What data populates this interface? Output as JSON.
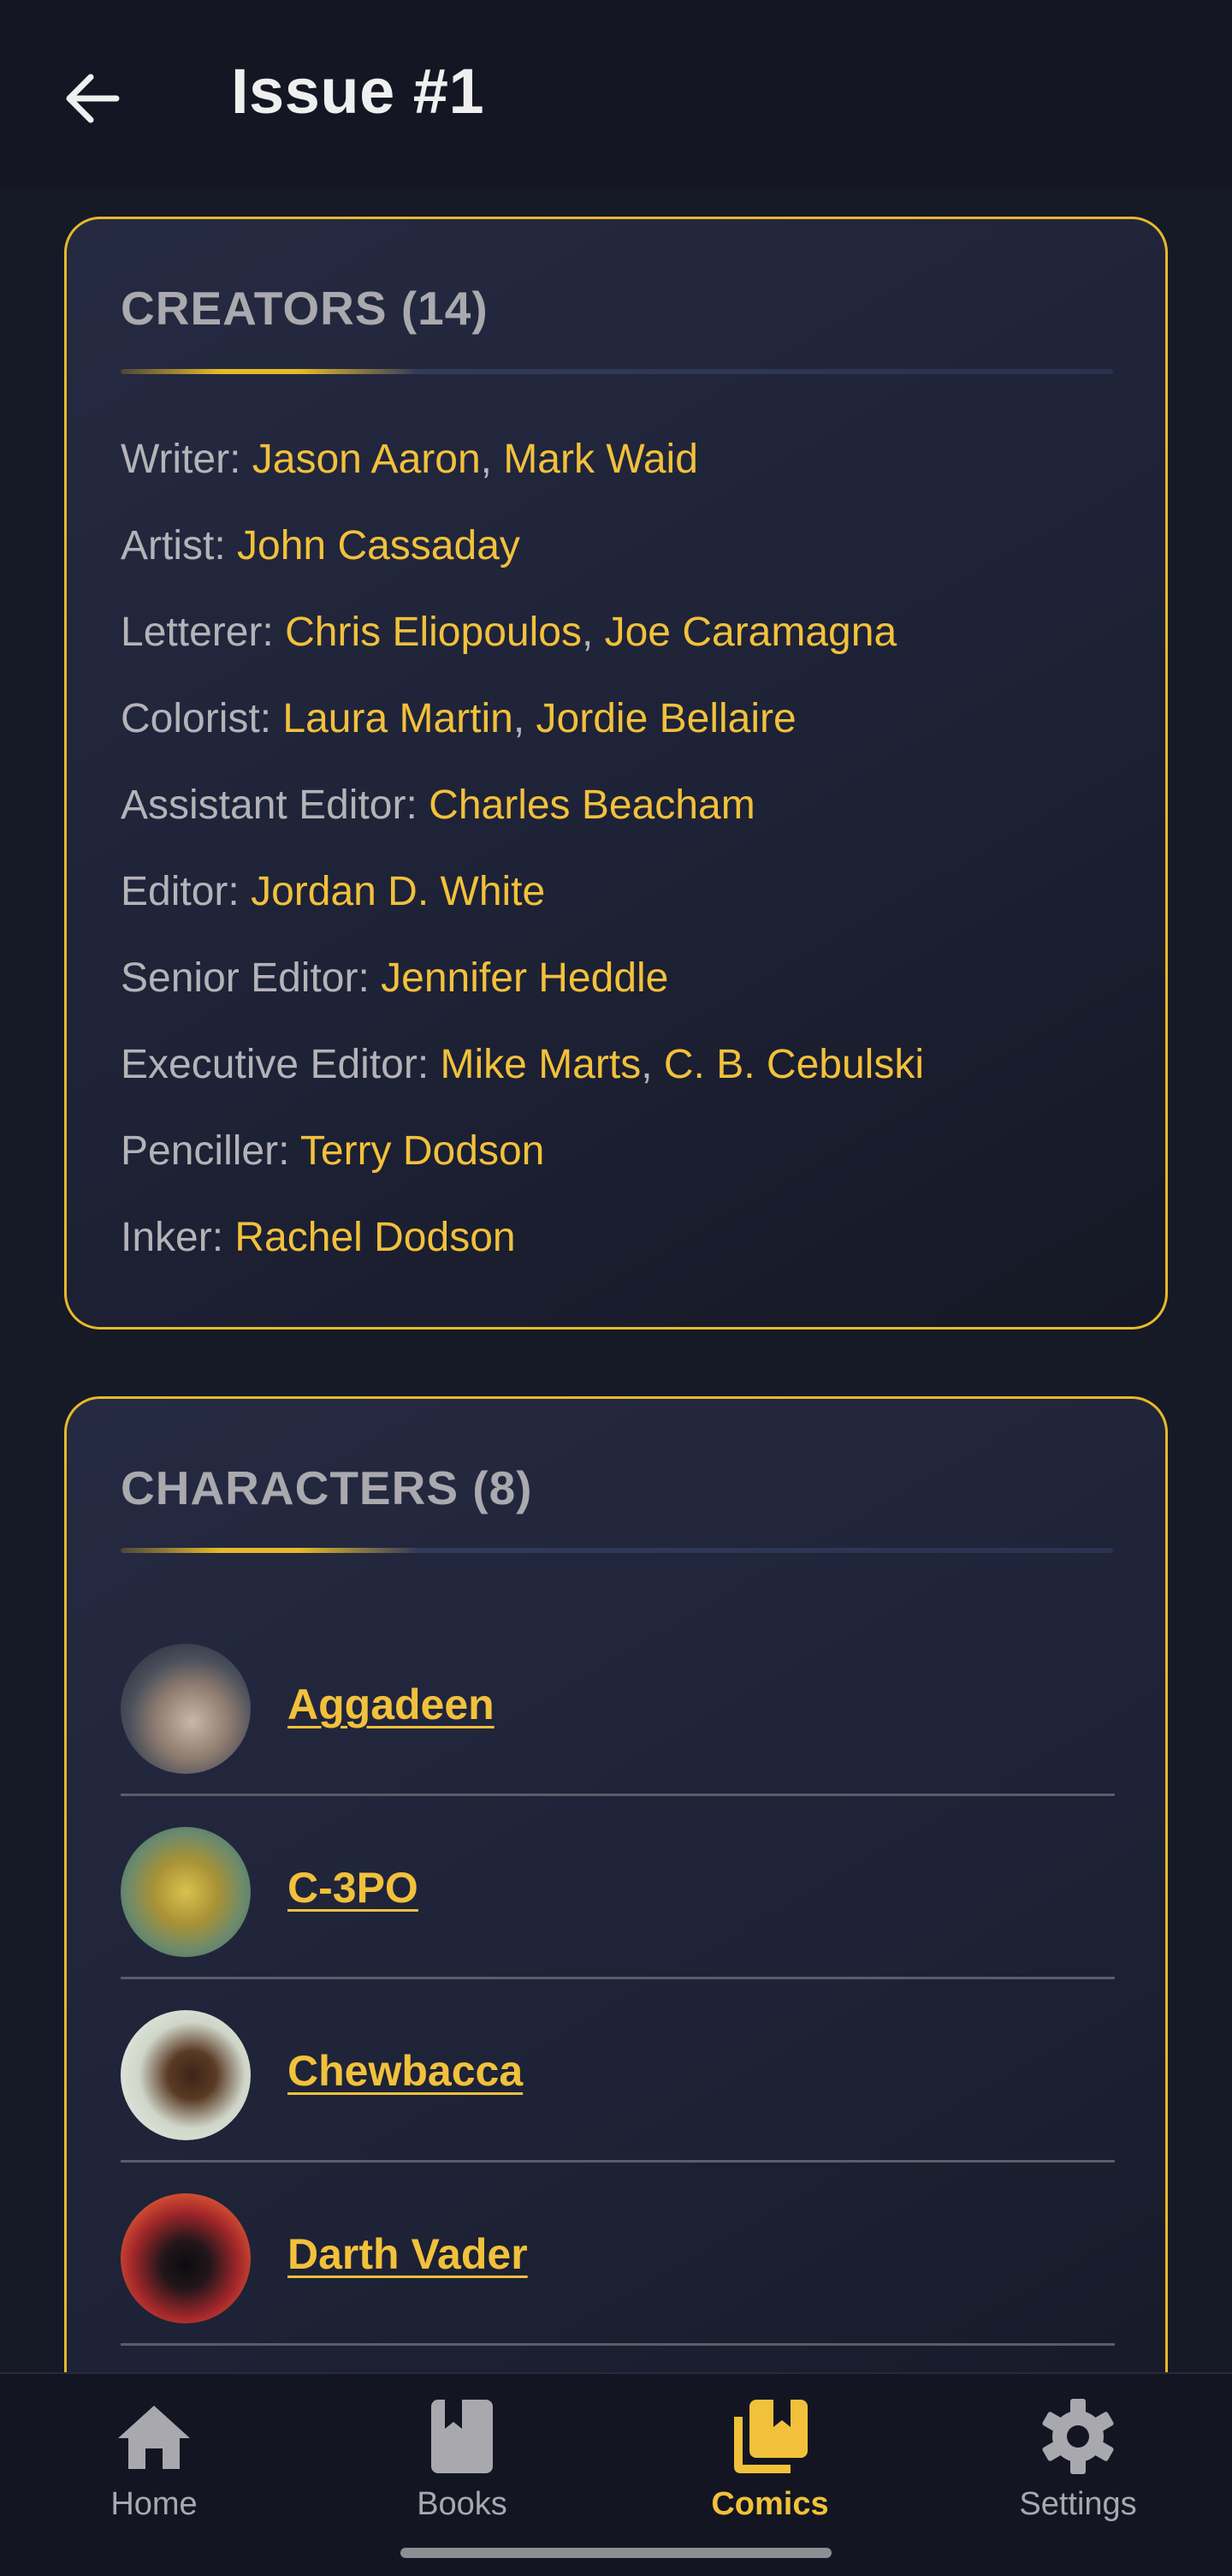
{
  "header": {
    "title": "Issue #1",
    "back_icon": "arrow-left-icon"
  },
  "creators": {
    "title": "CREATORS (14)",
    "roles": [
      {
        "role": "Writer:",
        "names": [
          "Jason Aaron",
          "Mark Waid"
        ]
      },
      {
        "role": "Artist:",
        "names": [
          "John Cassaday"
        ]
      },
      {
        "role": "Letterer:",
        "names": [
          "Chris Eliopoulos",
          "Joe Caramagna"
        ]
      },
      {
        "role": "Colorist:",
        "names": [
          "Laura Martin",
          "Jordie Bellaire"
        ]
      },
      {
        "role": "Assistant Editor:",
        "names": [
          "Charles Beacham"
        ]
      },
      {
        "role": "Editor:",
        "names": [
          "Jordan D. White"
        ]
      },
      {
        "role": "Senior Editor:",
        "names": [
          "Jennifer Heddle"
        ]
      },
      {
        "role": "Executive Editor:",
        "names": [
          "Mike Marts",
          "C. B. Cebulski"
        ]
      },
      {
        "role": "Penciller:",
        "names": [
          "Terry Dodson"
        ]
      },
      {
        "role": "Inker:",
        "names": [
          "Rachel Dodson"
        ]
      }
    ]
  },
  "characters": {
    "title": "CHARACTERS (8)",
    "items": [
      {
        "name": "Aggadeen"
      },
      {
        "name": "C-3PO"
      },
      {
        "name": "Chewbacca"
      },
      {
        "name": "Darth Vader"
      }
    ]
  },
  "bottom_nav": {
    "items": [
      {
        "label": "Home",
        "icon": "home-icon",
        "active": false
      },
      {
        "label": "Books",
        "icon": "book-icon",
        "active": false
      },
      {
        "label": "Comics",
        "icon": "comics-icon",
        "active": true
      },
      {
        "label": "Settings",
        "icon": "gear-icon",
        "active": false
      }
    ]
  },
  "colors": {
    "background": "#161926",
    "accent": "#f2c13b",
    "card_border": "#e6b92a",
    "muted_text": "#b3b3b8"
  }
}
